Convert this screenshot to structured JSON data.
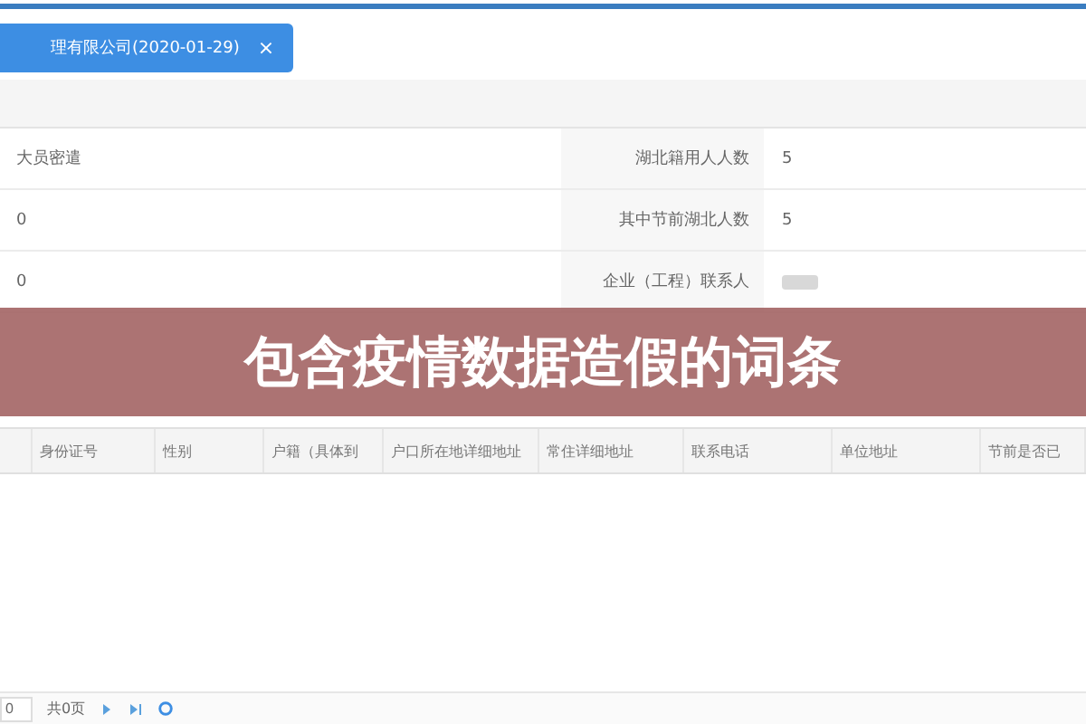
{
  "tab": {
    "label": "理有限公司(2020-01-29)",
    "close": "×",
    "selected": true
  },
  "form_rows": [
    {
      "left_value": "大员密遣",
      "label": "湖北籍用人人数",
      "value": "5"
    },
    {
      "left_value": "0",
      "label": "其中节前湖北人数",
      "value": "5"
    },
    {
      "left_value": "0",
      "label": "企业（工程）联系人",
      "value": ""
    }
  ],
  "banner": {
    "text": "包含疫情数据造假的词条"
  },
  "table": {
    "columns": [
      "身份证号",
      "性别",
      "户籍（具体到",
      "户口所在地详细地址",
      "常住详细地址",
      "联系电话",
      "单位地址",
      "节前是否已"
    ]
  },
  "pager": {
    "page": "0",
    "total": "共0页"
  }
}
